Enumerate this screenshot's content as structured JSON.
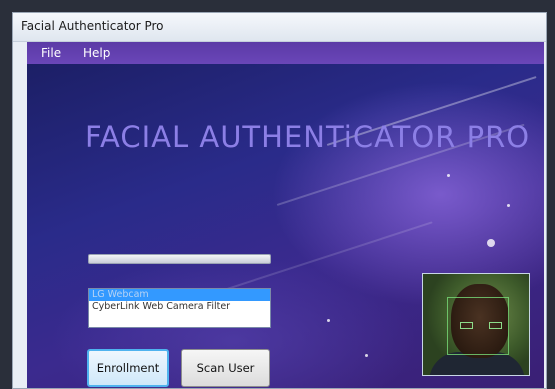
{
  "window": {
    "title": "Facial Authenticator Pro"
  },
  "menu": {
    "items": [
      "File",
      "Help"
    ]
  },
  "main": {
    "heading": "FACIAL AUTHENTiCATOR PRO",
    "progress_value": 0,
    "camera_list": {
      "items": [
        "LG Webcam",
        "CyberLink Web Camera Filter"
      ],
      "selected_index": 0
    },
    "buttons": {
      "enrollment": "Enrollment",
      "scan_user": "Scan User"
    }
  },
  "colors": {
    "menubar": "#6a46b8",
    "heading": "#8c7fe6",
    "selection": "#3399ff",
    "focused_button_border": "#4fb3ef"
  },
  "icons": {
    "camera_preview": "webcam-preview-icon"
  }
}
